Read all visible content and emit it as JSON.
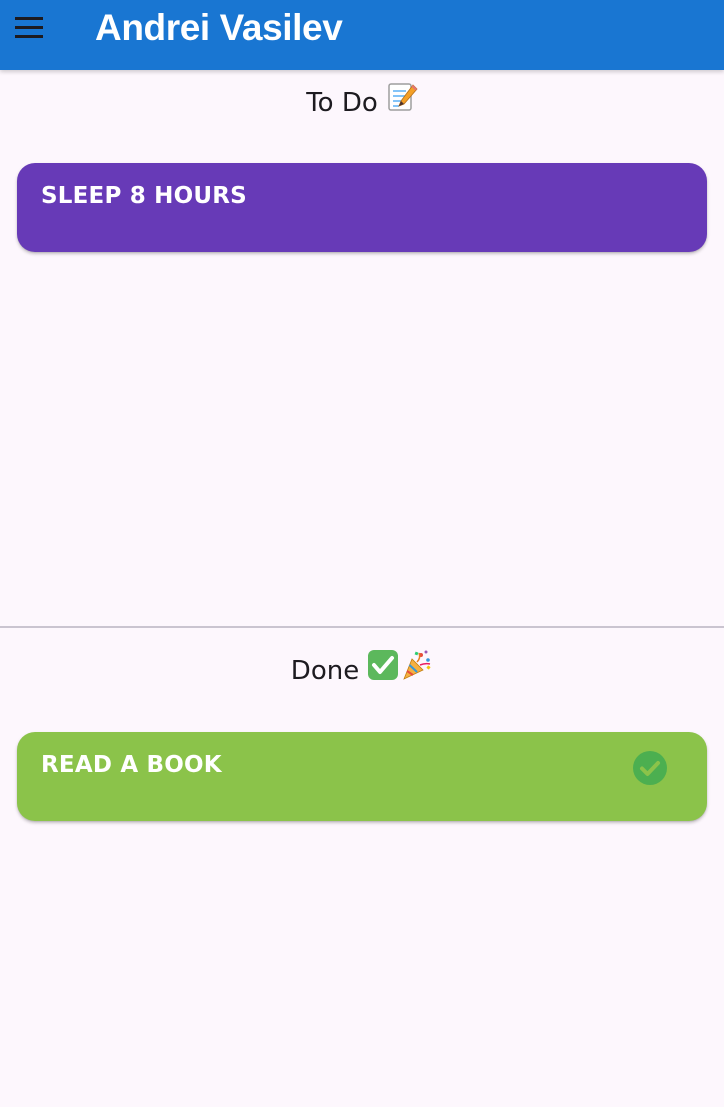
{
  "app_bar": {
    "title": "Andrei Vasilev",
    "menu_icon": "hamburger-menu-icon",
    "color": "#1976d2"
  },
  "todo_section": {
    "title": "To Do",
    "emoji_icon": "memo-pencil-icon",
    "items": [
      {
        "label": "SLEEP 8 HOURS",
        "color": "#673ab7"
      }
    ]
  },
  "done_section": {
    "title": "Done",
    "emoji_icons": [
      "check-mark-button-icon",
      "party-popper-icon"
    ],
    "items": [
      {
        "label": "READ A BOOK",
        "color": "#8bc34a",
        "status_icon": "check-circle-icon"
      }
    ]
  },
  "background": "#fdf7fd"
}
